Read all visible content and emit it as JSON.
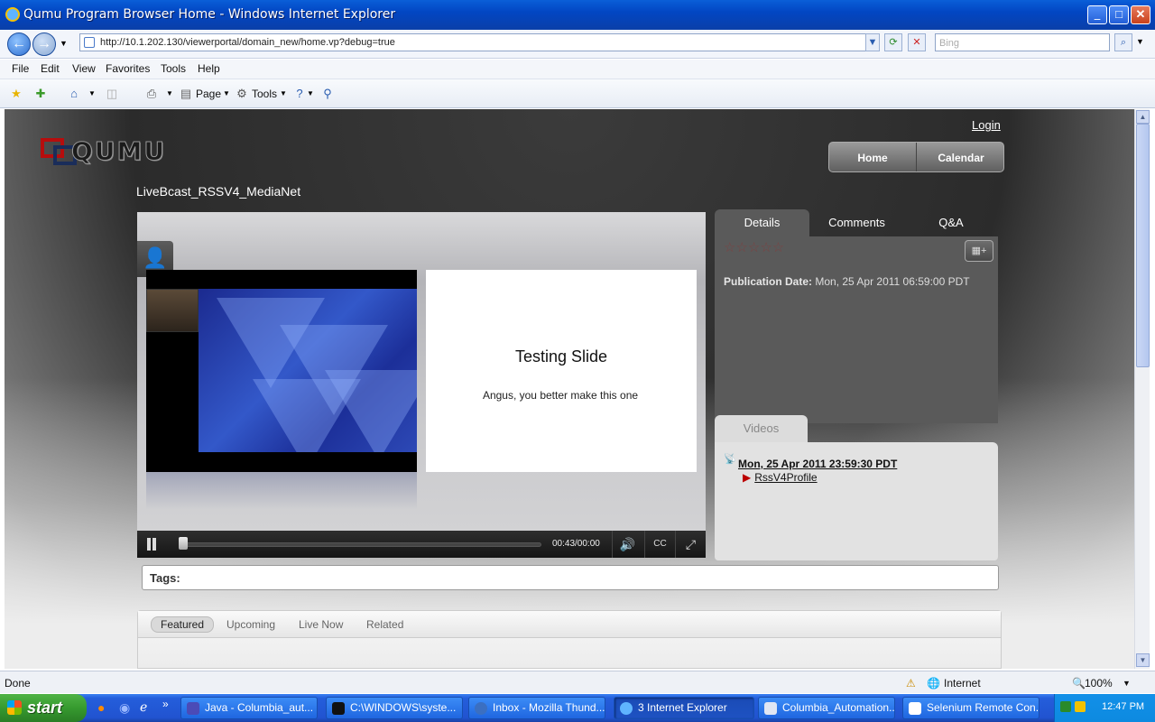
{
  "window": {
    "title": "Qumu Program Browser Home - Windows Internet Explorer"
  },
  "address": {
    "url": "http://10.1.202.130/viewerportal/domain_new/home.vp?debug=true",
    "search_placeholder": "Bing"
  },
  "menu": [
    "File",
    "Edit",
    "View",
    "Favorites",
    "Tools",
    "Help"
  ],
  "toolbar": {
    "page_label": "Page",
    "tools_label": "Tools"
  },
  "site": {
    "logo_text": "QUMU",
    "login": "Login",
    "nav": {
      "home": "Home",
      "calendar": "Calendar"
    },
    "program_title": "LiveBcast_RSSV4_MediaNet"
  },
  "player": {
    "slide_title": "Testing Slide",
    "slide_text": "Angus, you better make this one",
    "time": "00:43/00:00",
    "progress_fraction": 0.0
  },
  "panel": {
    "tabs": [
      "Details",
      "Comments",
      "Q&A"
    ],
    "rating": "☆☆☆☆☆",
    "pub_label": "Publication Date:",
    "pub_value": "Mon, 25 Apr 2011 06:59:00 PDT",
    "videos_tab": "Videos",
    "video_date": "Mon, 25 Apr 2011 23:59:30 PDT",
    "video_profile": "RssV4Profile"
  },
  "tags_label": "Tags:",
  "bottom_tabs": [
    "Featured",
    "Upcoming",
    "Live Now",
    "Related"
  ],
  "status": {
    "text": "Done",
    "zone": "Internet",
    "zoom": "100%"
  },
  "taskbar": {
    "start": "start",
    "tasks": [
      "Java - Columbia_aut...",
      "C:\\WINDOWS\\syste...",
      "Inbox - Mozilla Thund...",
      "3 Internet Explorer",
      "Columbia_Automation...",
      "Selenium Remote Con..."
    ],
    "clock": "12:47 PM"
  },
  "colors": {
    "title_blue": "#0246c3",
    "page_dark": "#2b2b2b",
    "panel_gray": "#5a5a5a",
    "star_color": "#7a4444"
  }
}
